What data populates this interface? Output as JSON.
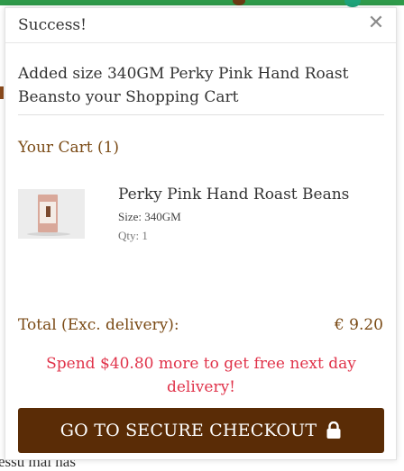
{
  "background": {
    "bottom_text": "essu mai nas"
  },
  "modal": {
    "title": "Success!",
    "close_icon": "close-icon",
    "added_message": "Added size 340GM Perky Pink Hand Roast Beansto your Shopping Cart",
    "cart_heading": "Your Cart (1)",
    "item": {
      "name": "Perky Pink Hand Roast Beans",
      "size": "Size: 340GM",
      "qty": "Qty: 1"
    },
    "total_label": "Total (Exc. delivery):",
    "total_value": "€ 9.20",
    "promo": "Spend $40.80 more to get free next day delivery!",
    "checkout_label": "GO TO SECURE CHECKOUT",
    "checkout_icon": "lock-icon"
  },
  "colors": {
    "brand_brown": "#5a2c06",
    "accent_text": "#7a4a15",
    "promo_red": "#e0334a"
  }
}
